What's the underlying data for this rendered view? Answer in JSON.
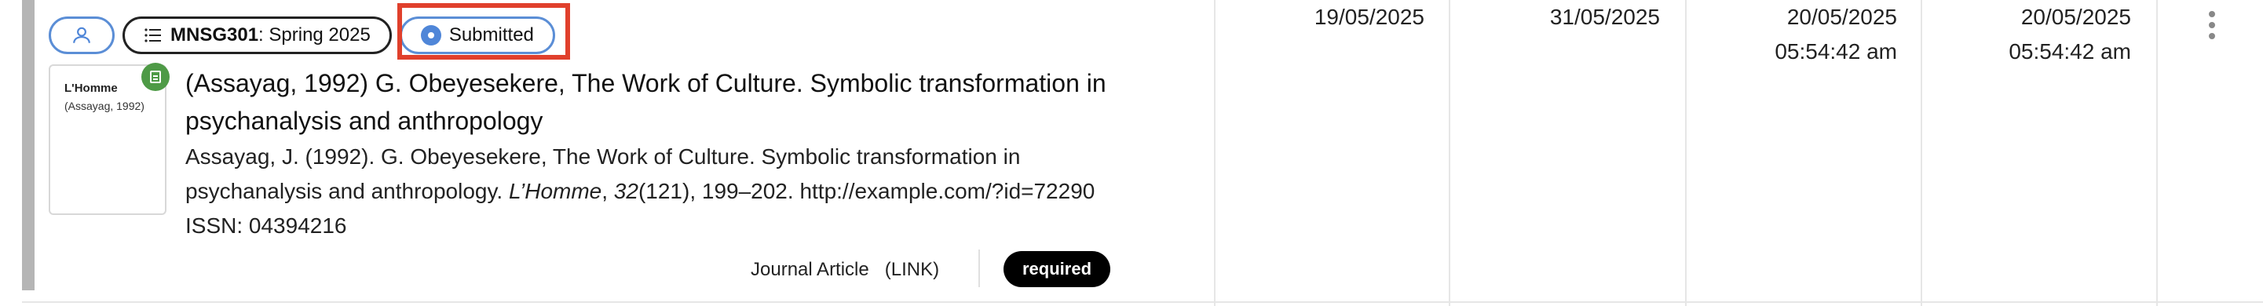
{
  "chips": {
    "avatar_icon": "user-icon",
    "course_code": "MNSG301",
    "course_rest": ": Spring 2025",
    "status": "Submitted"
  },
  "thumbnail": {
    "title": "L'Homme",
    "subtitle": "(Assayag, 1992)"
  },
  "item": {
    "title": "(Assayag, 1992) G. Obeyesekere, The Work of Culture. Symbolic transformation in psychanalysis and anthropology",
    "citation_prefix": "Assayag, J. (1992). G. Obeyesekere, The Work of Culture. Symbolic transformation in psychanalysis and anthropology. ",
    "journal": "L’Homme",
    "volume": "32",
    "citation_suffix": "(121), 199–202. http://example.com/?id=72290",
    "issn": "ISSN: 04394216",
    "type": "Journal Article",
    "link_label": "(LINK)",
    "required_label": "required"
  },
  "columns": {
    "date1": "19/05/2025",
    "date2": "31/05/2025",
    "date3_date": "20/05/2025",
    "date3_time": "05:54:42 am",
    "date4_date": "20/05/2025",
    "date4_time": "05:54:42 am"
  }
}
